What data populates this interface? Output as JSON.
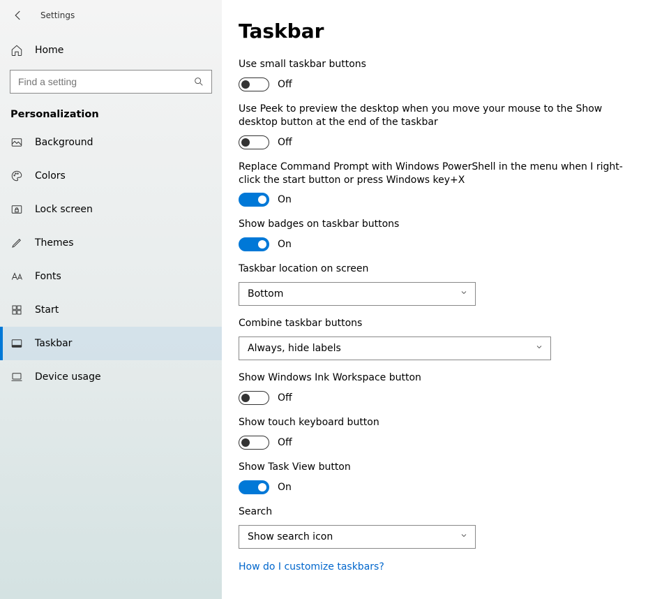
{
  "header": {
    "app_title": "Settings"
  },
  "sidebar": {
    "home": "Home",
    "search_placeholder": "Find a setting",
    "section": "Personalization",
    "items": [
      {
        "id": "background",
        "label": "Background",
        "icon": "image-icon",
        "active": false
      },
      {
        "id": "colors",
        "label": "Colors",
        "icon": "palette-icon",
        "active": false
      },
      {
        "id": "lock-screen",
        "label": "Lock screen",
        "icon": "lockscreen-icon",
        "active": false
      },
      {
        "id": "themes",
        "label": "Themes",
        "icon": "pencil-icon",
        "active": false
      },
      {
        "id": "fonts",
        "label": "Fonts",
        "icon": "fonts-icon",
        "active": false
      },
      {
        "id": "start",
        "label": "Start",
        "icon": "start-icon",
        "active": false
      },
      {
        "id": "taskbar",
        "label": "Taskbar",
        "icon": "taskbar-icon",
        "active": true
      },
      {
        "id": "device-usage",
        "label": "Device usage",
        "icon": "laptop-icon",
        "active": false
      }
    ]
  },
  "main": {
    "title": "Taskbar",
    "on_label": "On",
    "off_label": "Off",
    "help_link": "How do I customize taskbars?",
    "settings": [
      {
        "type": "toggle",
        "id": "small-buttons",
        "label": "Use small taskbar buttons",
        "value": false
      },
      {
        "type": "toggle",
        "id": "peek-preview",
        "label": "Use Peek to preview the desktop when you move your mouse to the Show desktop button at the end of the taskbar",
        "value": false
      },
      {
        "type": "toggle",
        "id": "powershell-replace",
        "label": "Replace Command Prompt with Windows PowerShell in the menu when I right-click the start button or press Windows key+X",
        "value": true
      },
      {
        "type": "toggle",
        "id": "show-badges",
        "label": "Show badges on taskbar buttons",
        "value": true
      },
      {
        "type": "dropdown",
        "id": "taskbar-location",
        "label": "Taskbar location on screen",
        "value": "Bottom",
        "size": "small"
      },
      {
        "type": "dropdown",
        "id": "combine-buttons",
        "label": "Combine taskbar buttons",
        "value": "Always, hide labels",
        "size": "large"
      },
      {
        "type": "toggle",
        "id": "ink-workspace",
        "label": "Show Windows Ink Workspace button",
        "value": false
      },
      {
        "type": "toggle",
        "id": "touch-keyboard",
        "label": "Show touch keyboard button",
        "value": false
      },
      {
        "type": "toggle",
        "id": "task-view",
        "label": "Show Task View button",
        "value": true
      },
      {
        "type": "dropdown",
        "id": "search-mode",
        "label": "Search",
        "value": "Show search icon",
        "size": "small"
      }
    ]
  }
}
